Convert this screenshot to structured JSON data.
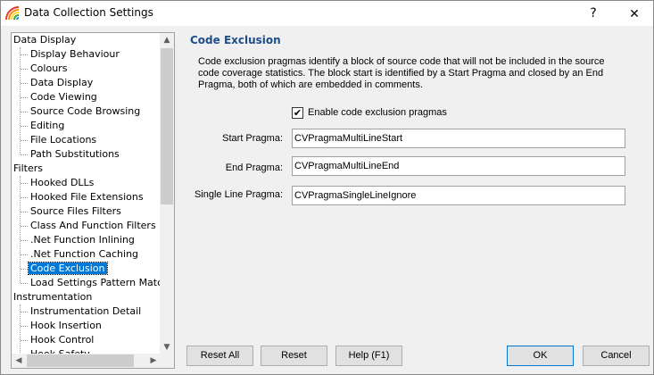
{
  "window": {
    "title": "Data Collection Settings",
    "help_glyph": "?",
    "close_glyph": "✕"
  },
  "tree": {
    "items": [
      {
        "label": "Data Display",
        "level": 0
      },
      {
        "label": "Display Behaviour",
        "level": 1
      },
      {
        "label": "Colours",
        "level": 1
      },
      {
        "label": "Data Display",
        "level": 1
      },
      {
        "label": "Code Viewing",
        "level": 1
      },
      {
        "label": "Source Code Browsing",
        "level": 1
      },
      {
        "label": "Editing",
        "level": 1
      },
      {
        "label": "File Locations",
        "level": 1
      },
      {
        "label": "Path Substitutions",
        "level": 1
      },
      {
        "label": "Filters",
        "level": 0
      },
      {
        "label": "Hooked DLLs",
        "level": 1
      },
      {
        "label": "Hooked File Extensions",
        "level": 1
      },
      {
        "label": "Source Files Filters",
        "level": 1
      },
      {
        "label": "Class And Function Filters",
        "level": 1
      },
      {
        "label": ".Net Function Inlining",
        "level": 1
      },
      {
        "label": ".Net Function Caching",
        "level": 1
      },
      {
        "label": "Code Exclusion",
        "level": 1,
        "selected": true
      },
      {
        "label": "Load Settings Pattern Match",
        "level": 1
      },
      {
        "label": "Instrumentation",
        "level": 0
      },
      {
        "label": "Instrumentation Detail",
        "level": 1
      },
      {
        "label": "Hook Insertion",
        "level": 1
      },
      {
        "label": "Hook Control",
        "level": 1
      },
      {
        "label": "Hook Safety",
        "level": 1
      }
    ]
  },
  "panel": {
    "title": "Code Exclusion",
    "description": "Code exclusion pragmas identify a block of source code that will not be included in the source code coverage statistics. The block start is identified by a Start Pragma and closed by an End Pragma, both of which are embedded in comments.",
    "enable_checkbox": {
      "label": "Enable code exclusion pragmas",
      "checked": true,
      "mark": "✔"
    },
    "start_pragma": {
      "label": "Start Pragma:",
      "value": "CVPragmaMultiLineStart"
    },
    "end_pragma": {
      "label": "End Pragma:",
      "value": "CVPragmaMultiLineEnd"
    },
    "single_line_pragma": {
      "label": "Single Line Pragma:",
      "value": "CVPragmaSingleLineIgnore"
    }
  },
  "buttons": {
    "reset_all": "Reset All",
    "reset": "Reset",
    "help": "Help (F1)",
    "ok": "OK",
    "cancel": "Cancel"
  },
  "scroll_arrows": {
    "up": "▲",
    "down": "▼",
    "left": "◀",
    "right": "▶"
  }
}
